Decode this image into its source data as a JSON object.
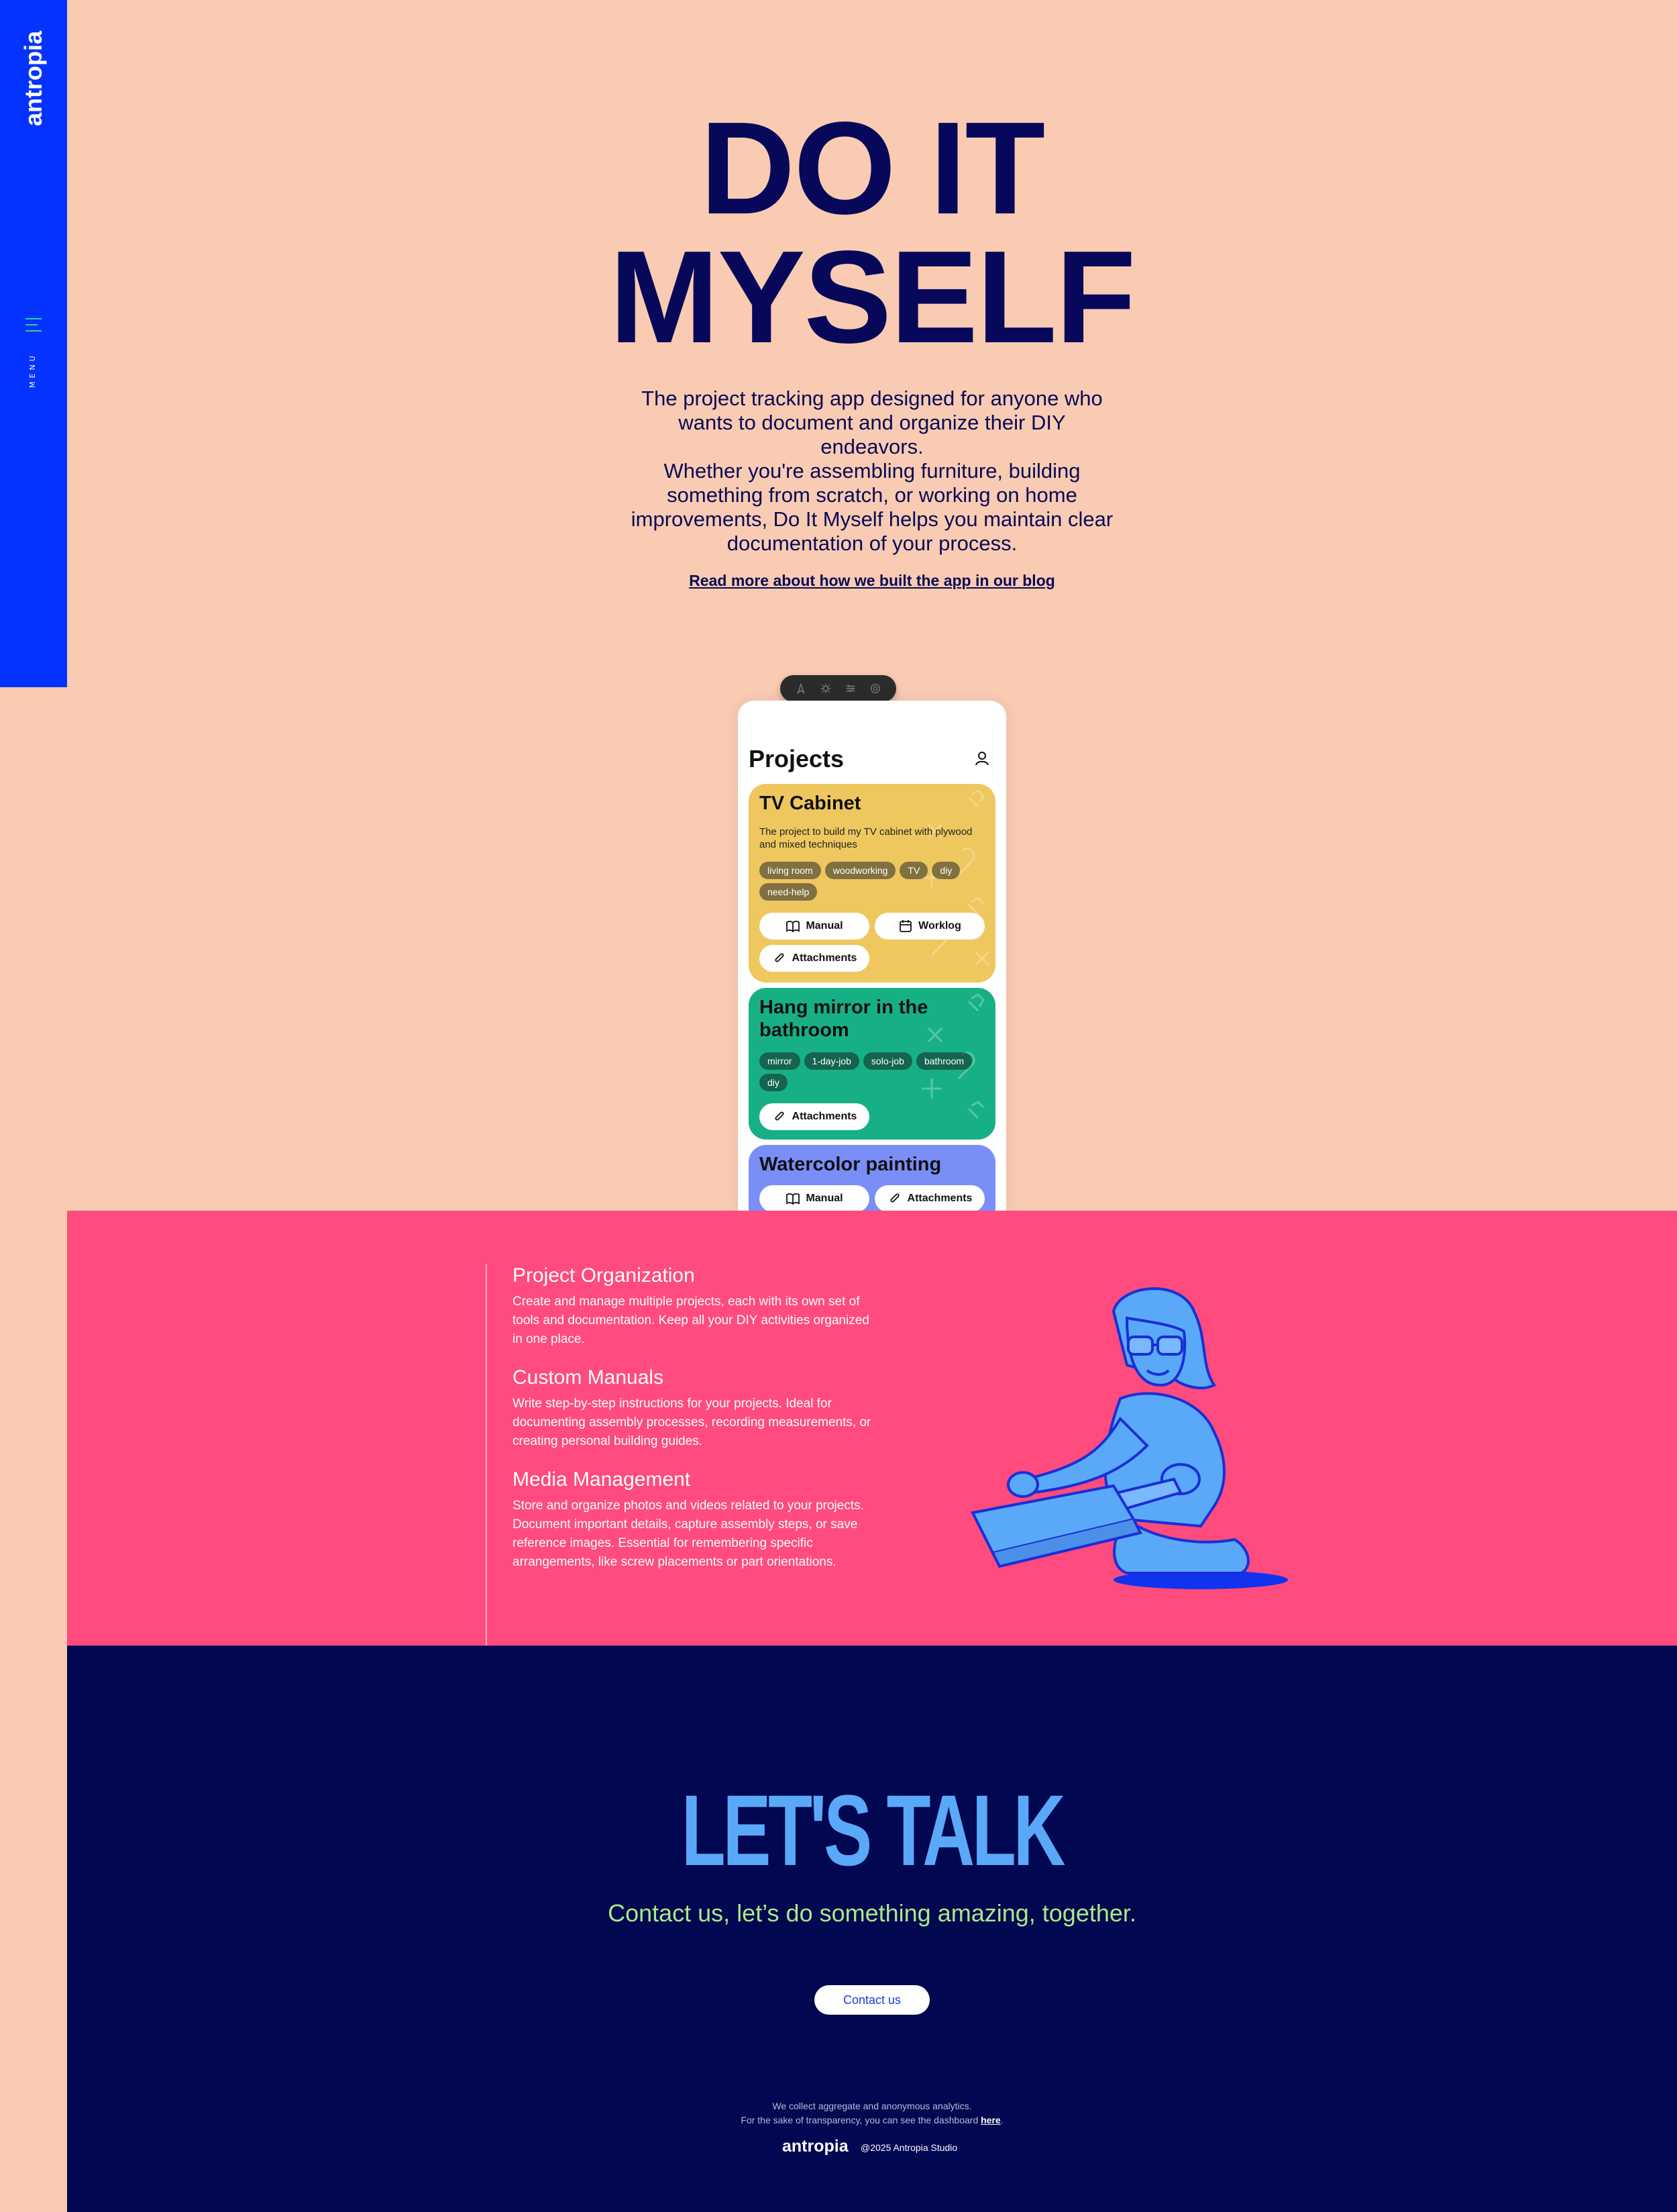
{
  "sidebar": {
    "logo_text": "antropia",
    "menu_label": "MENU"
  },
  "hero": {
    "title_line1": "DO IT",
    "title_line2": "MYSELF",
    "paragraph1": "The project tracking app designed for anyone who wants to document and organize their DIY endeavors.",
    "paragraph2": "Whether you're assembling furniture, building something from scratch, or working on home improvements, Do It Myself helps you maintain clear documentation of your process.",
    "blog_link": "Read more about how we built the app in our blog"
  },
  "app": {
    "title": "Projects",
    "toolbar_icons": [
      "cursor-icon",
      "settings-icon",
      "sliders-icon",
      "target-icon"
    ],
    "cards": [
      {
        "title": "TV Cabinet",
        "description": "The project to build my TV cabinet with plywood and mixed techniques",
        "tags": [
          "living room",
          "woodworking",
          "TV",
          "diy",
          "need-help"
        ],
        "buttons": [
          "Manual",
          "Worklog",
          "Attachments"
        ],
        "color": "#eec75e"
      },
      {
        "title": "Hang mirror in the bathroom",
        "tags": [
          "mirror",
          "1-day-job",
          "solo-job",
          "bathroom",
          "diy"
        ],
        "buttons": [
          "Attachments"
        ],
        "color": "#17b086"
      },
      {
        "title": "Watercolor painting",
        "buttons": [
          "Manual",
          "Attachments"
        ],
        "color": "#7a8ef8"
      }
    ]
  },
  "features": [
    {
      "title": "Project Organization",
      "text": "Create and manage multiple projects, each with its own set of tools and documentation. Keep all your DIY activities organized in one place."
    },
    {
      "title": "Custom Manuals",
      "text": "Write step-by-step instructions for your projects. Ideal for documenting assembly processes, recording measurements, or creating personal building guides."
    },
    {
      "title": "Media Management",
      "text": "Store and organize photos and videos related to your projects. Document important details, capture assembly steps, or save reference images. Essential for remembering specific arrangements, like screw placements or part orientations."
    }
  ],
  "contact": {
    "heading": "LET'S TALK",
    "subtitle": "Contact us, let’s do something amazing, together.",
    "button": "Contact us",
    "analytics_line1": "We collect aggregate and anonymous analytics.",
    "analytics_line2": "For the sake of transparency, you can see the dashboard",
    "analytics_link": "here",
    "footer_logo": "antropia",
    "copyright": "@2025 Antropia Studio"
  },
  "colors": {
    "background": "#f8cbb2",
    "sidebar": "#0433ff",
    "features": "#ff4b7d",
    "contact": "#020751",
    "accent_green": "#1fd59a",
    "talk_blue": "#5aa9f8",
    "subtitle_green": "#a8ea84"
  }
}
